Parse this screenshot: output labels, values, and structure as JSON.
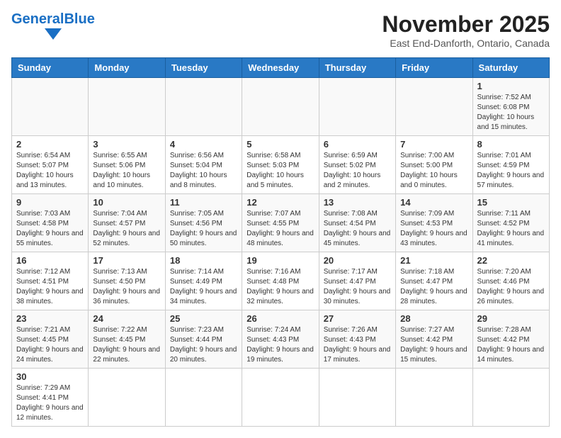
{
  "header": {
    "logo_general": "General",
    "logo_blue": "Blue",
    "month_title": "November 2025",
    "subtitle": "East End-Danforth, Ontario, Canada"
  },
  "weekdays": [
    "Sunday",
    "Monday",
    "Tuesday",
    "Wednesday",
    "Thursday",
    "Friday",
    "Saturday"
  ],
  "weeks": [
    [
      {
        "day": "",
        "info": ""
      },
      {
        "day": "",
        "info": ""
      },
      {
        "day": "",
        "info": ""
      },
      {
        "day": "",
        "info": ""
      },
      {
        "day": "",
        "info": ""
      },
      {
        "day": "",
        "info": ""
      },
      {
        "day": "1",
        "info": "Sunrise: 7:52 AM\nSunset: 6:08 PM\nDaylight: 10 hours and 15 minutes."
      }
    ],
    [
      {
        "day": "2",
        "info": "Sunrise: 6:54 AM\nSunset: 5:07 PM\nDaylight: 10 hours and 13 minutes."
      },
      {
        "day": "3",
        "info": "Sunrise: 6:55 AM\nSunset: 5:06 PM\nDaylight: 10 hours and 10 minutes."
      },
      {
        "day": "4",
        "info": "Sunrise: 6:56 AM\nSunset: 5:04 PM\nDaylight: 10 hours and 8 minutes."
      },
      {
        "day": "5",
        "info": "Sunrise: 6:58 AM\nSunset: 5:03 PM\nDaylight: 10 hours and 5 minutes."
      },
      {
        "day": "6",
        "info": "Sunrise: 6:59 AM\nSunset: 5:02 PM\nDaylight: 10 hours and 2 minutes."
      },
      {
        "day": "7",
        "info": "Sunrise: 7:00 AM\nSunset: 5:00 PM\nDaylight: 10 hours and 0 minutes."
      },
      {
        "day": "8",
        "info": "Sunrise: 7:01 AM\nSunset: 4:59 PM\nDaylight: 9 hours and 57 minutes."
      }
    ],
    [
      {
        "day": "9",
        "info": "Sunrise: 7:03 AM\nSunset: 4:58 PM\nDaylight: 9 hours and 55 minutes."
      },
      {
        "day": "10",
        "info": "Sunrise: 7:04 AM\nSunset: 4:57 PM\nDaylight: 9 hours and 52 minutes."
      },
      {
        "day": "11",
        "info": "Sunrise: 7:05 AM\nSunset: 4:56 PM\nDaylight: 9 hours and 50 minutes."
      },
      {
        "day": "12",
        "info": "Sunrise: 7:07 AM\nSunset: 4:55 PM\nDaylight: 9 hours and 48 minutes."
      },
      {
        "day": "13",
        "info": "Sunrise: 7:08 AM\nSunset: 4:54 PM\nDaylight: 9 hours and 45 minutes."
      },
      {
        "day": "14",
        "info": "Sunrise: 7:09 AM\nSunset: 4:53 PM\nDaylight: 9 hours and 43 minutes."
      },
      {
        "day": "15",
        "info": "Sunrise: 7:11 AM\nSunset: 4:52 PM\nDaylight: 9 hours and 41 minutes."
      }
    ],
    [
      {
        "day": "16",
        "info": "Sunrise: 7:12 AM\nSunset: 4:51 PM\nDaylight: 9 hours and 38 minutes."
      },
      {
        "day": "17",
        "info": "Sunrise: 7:13 AM\nSunset: 4:50 PM\nDaylight: 9 hours and 36 minutes."
      },
      {
        "day": "18",
        "info": "Sunrise: 7:14 AM\nSunset: 4:49 PM\nDaylight: 9 hours and 34 minutes."
      },
      {
        "day": "19",
        "info": "Sunrise: 7:16 AM\nSunset: 4:48 PM\nDaylight: 9 hours and 32 minutes."
      },
      {
        "day": "20",
        "info": "Sunrise: 7:17 AM\nSunset: 4:47 PM\nDaylight: 9 hours and 30 minutes."
      },
      {
        "day": "21",
        "info": "Sunrise: 7:18 AM\nSunset: 4:47 PM\nDaylight: 9 hours and 28 minutes."
      },
      {
        "day": "22",
        "info": "Sunrise: 7:20 AM\nSunset: 4:46 PM\nDaylight: 9 hours and 26 minutes."
      }
    ],
    [
      {
        "day": "23",
        "info": "Sunrise: 7:21 AM\nSunset: 4:45 PM\nDaylight: 9 hours and 24 minutes."
      },
      {
        "day": "24",
        "info": "Sunrise: 7:22 AM\nSunset: 4:45 PM\nDaylight: 9 hours and 22 minutes."
      },
      {
        "day": "25",
        "info": "Sunrise: 7:23 AM\nSunset: 4:44 PM\nDaylight: 9 hours and 20 minutes."
      },
      {
        "day": "26",
        "info": "Sunrise: 7:24 AM\nSunset: 4:43 PM\nDaylight: 9 hours and 19 minutes."
      },
      {
        "day": "27",
        "info": "Sunrise: 7:26 AM\nSunset: 4:43 PM\nDaylight: 9 hours and 17 minutes."
      },
      {
        "day": "28",
        "info": "Sunrise: 7:27 AM\nSunset: 4:42 PM\nDaylight: 9 hours and 15 minutes."
      },
      {
        "day": "29",
        "info": "Sunrise: 7:28 AM\nSunset: 4:42 PM\nDaylight: 9 hours and 14 minutes."
      }
    ],
    [
      {
        "day": "30",
        "info": "Sunrise: 7:29 AM\nSunset: 4:41 PM\nDaylight: 9 hours and 12 minutes."
      },
      {
        "day": "",
        "info": ""
      },
      {
        "day": "",
        "info": ""
      },
      {
        "day": "",
        "info": ""
      },
      {
        "day": "",
        "info": ""
      },
      {
        "day": "",
        "info": ""
      },
      {
        "day": "",
        "info": ""
      }
    ]
  ]
}
